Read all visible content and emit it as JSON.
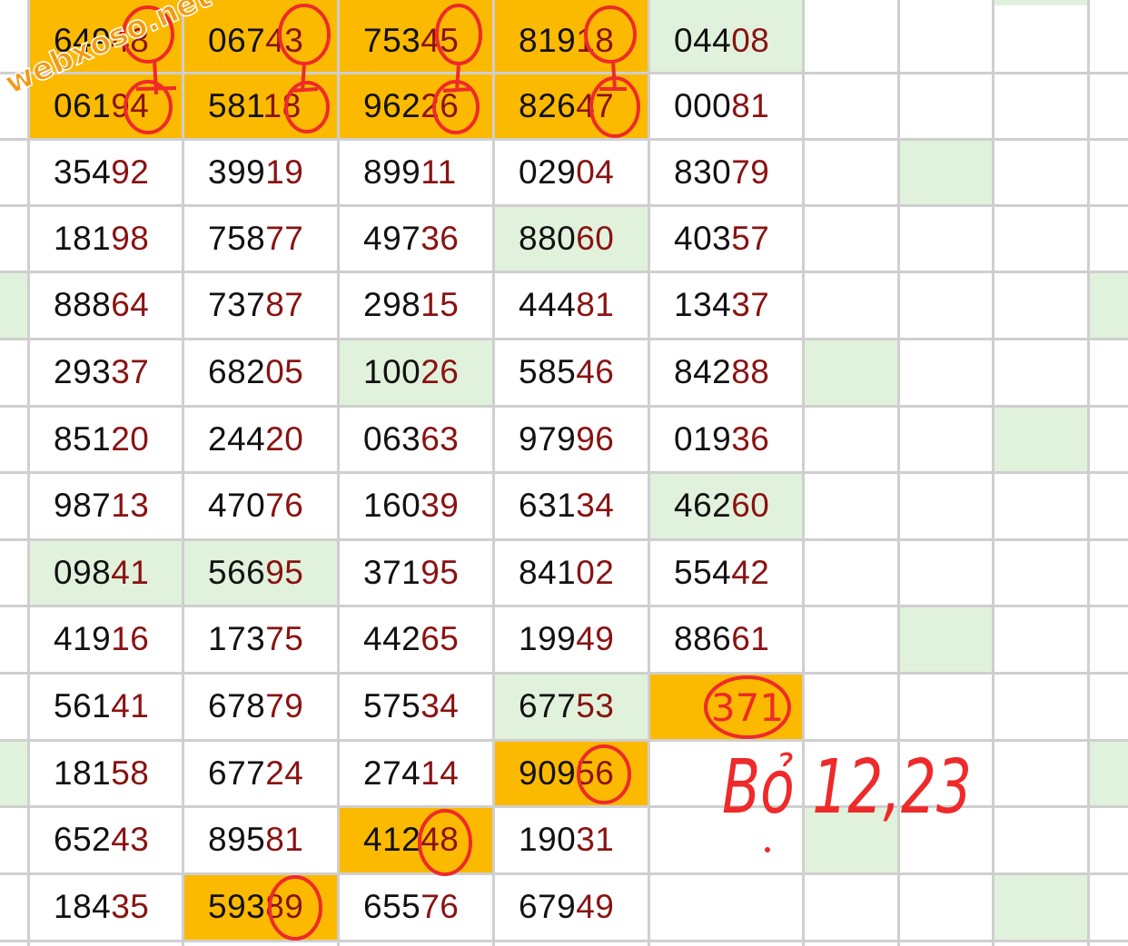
{
  "colors": {
    "gridline": "#cfcfcf",
    "orange_highlight": "#fbb900",
    "green_highlight": "#e1f2dc",
    "head_digits": "#111111",
    "tail_digits": "#8a1212",
    "pen_red": "#ee2a2a",
    "watermark_orange": "#f29a17"
  },
  "watermark": "webxoso.net",
  "grid": {
    "rows": [
      [
        "64948",
        "06743",
        "75345",
        "81918",
        "04408"
      ],
      [
        "06194",
        "58118",
        "96226",
        "82647",
        "00081"
      ],
      [
        "35492",
        "39919",
        "89911",
        "02904",
        "83079"
      ],
      [
        "18198",
        "75877",
        "49736",
        "88060",
        "40357"
      ],
      [
        "88864",
        "73787",
        "29815",
        "44481",
        "13437"
      ],
      [
        "29337",
        "68205",
        "10026",
        "58546",
        "84288"
      ],
      [
        "85120",
        "24420",
        "06363",
        "97996",
        "01936"
      ],
      [
        "98713",
        "47076",
        "16039",
        "63134",
        "46260"
      ],
      [
        "09841",
        "56695",
        "37195",
        "84102",
        "55442"
      ],
      [
        "41916",
        "17375",
        "44265",
        "19949",
        "88661"
      ],
      [
        "56141",
        "67879",
        "57534",
        "67753",
        ""
      ],
      [
        "18158",
        "67724",
        "27414",
        "90956",
        ""
      ],
      [
        "65243",
        "89581",
        "41248",
        "19031",
        ""
      ],
      [
        "18435",
        "59389",
        "65576",
        "67949",
        ""
      ]
    ],
    "orange_cells": [
      [
        0,
        0
      ],
      [
        0,
        1
      ],
      [
        0,
        2
      ],
      [
        0,
        3
      ],
      [
        1,
        0
      ],
      [
        1,
        1
      ],
      [
        1,
        2
      ],
      [
        1,
        3
      ],
      [
        10,
        4
      ],
      [
        11,
        3
      ],
      [
        12,
        2
      ],
      [
        13,
        1
      ]
    ],
    "green_cells": [
      [
        0,
        4
      ],
      [
        3,
        3
      ],
      [
        5,
        2
      ],
      [
        7,
        4
      ],
      [
        8,
        0
      ],
      [
        8,
        1
      ],
      [
        10,
        3
      ]
    ],
    "right_green_cells": [
      [
        -1,
        2
      ],
      [
        2,
        1
      ],
      [
        5,
        0
      ],
      [
        6,
        2
      ],
      [
        9,
        1
      ],
      [
        12,
        0
      ],
      [
        13,
        2
      ],
      [
        4,
        3
      ],
      [
        11,
        3
      ],
      [
        4,
        -1
      ],
      [
        11,
        -1
      ]
    ]
  },
  "annotations": {
    "circled_total": "371",
    "note": "Bỏ 12,23"
  }
}
